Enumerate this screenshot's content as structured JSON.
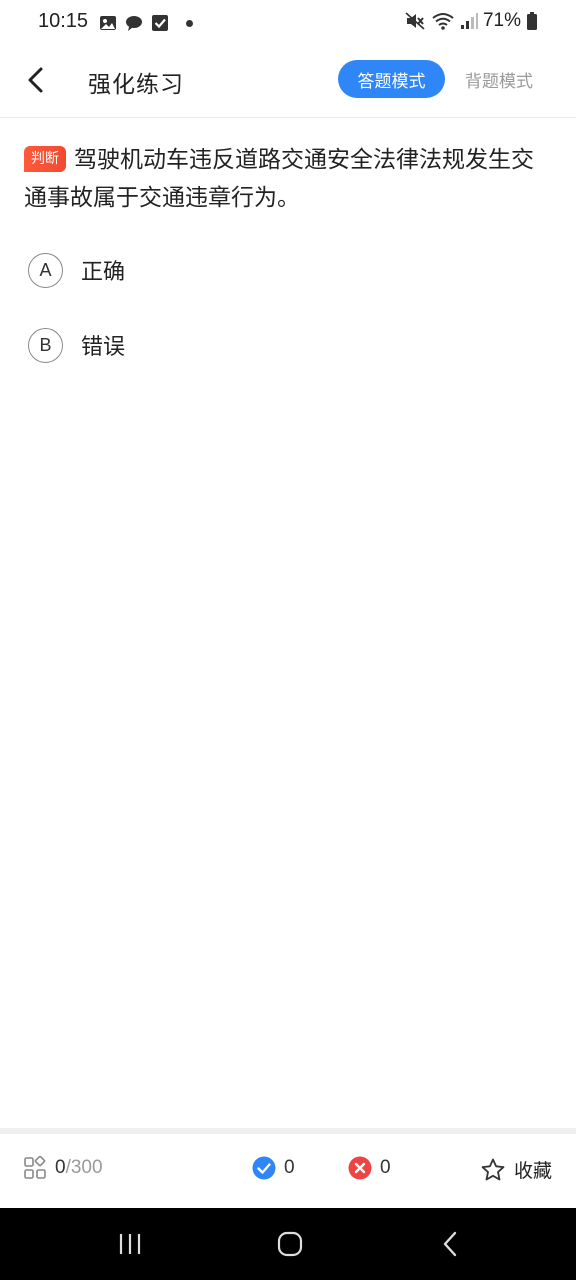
{
  "status_bar": {
    "time": "10:15",
    "battery": "71%"
  },
  "header": {
    "title": "强化练习",
    "mode_answer": "答题模式",
    "mode_recite": "背题模式"
  },
  "question": {
    "tag": "判断",
    "text": "驾驶机动车违反道路交通安全法律法规发生交通事故属于交通违章行为。",
    "options": [
      {
        "letter": "A",
        "text": "正确"
      },
      {
        "letter": "B",
        "text": "错误"
      }
    ]
  },
  "bottom_bar": {
    "progress_current": "0",
    "progress_total": "/300",
    "correct_count": "0",
    "wrong_count": "0",
    "favorite_label": "收藏"
  },
  "colors": {
    "accent": "#2f86f6",
    "tag": "#f24a31",
    "correct": "#2f86f6",
    "wrong": "#ef4444"
  }
}
